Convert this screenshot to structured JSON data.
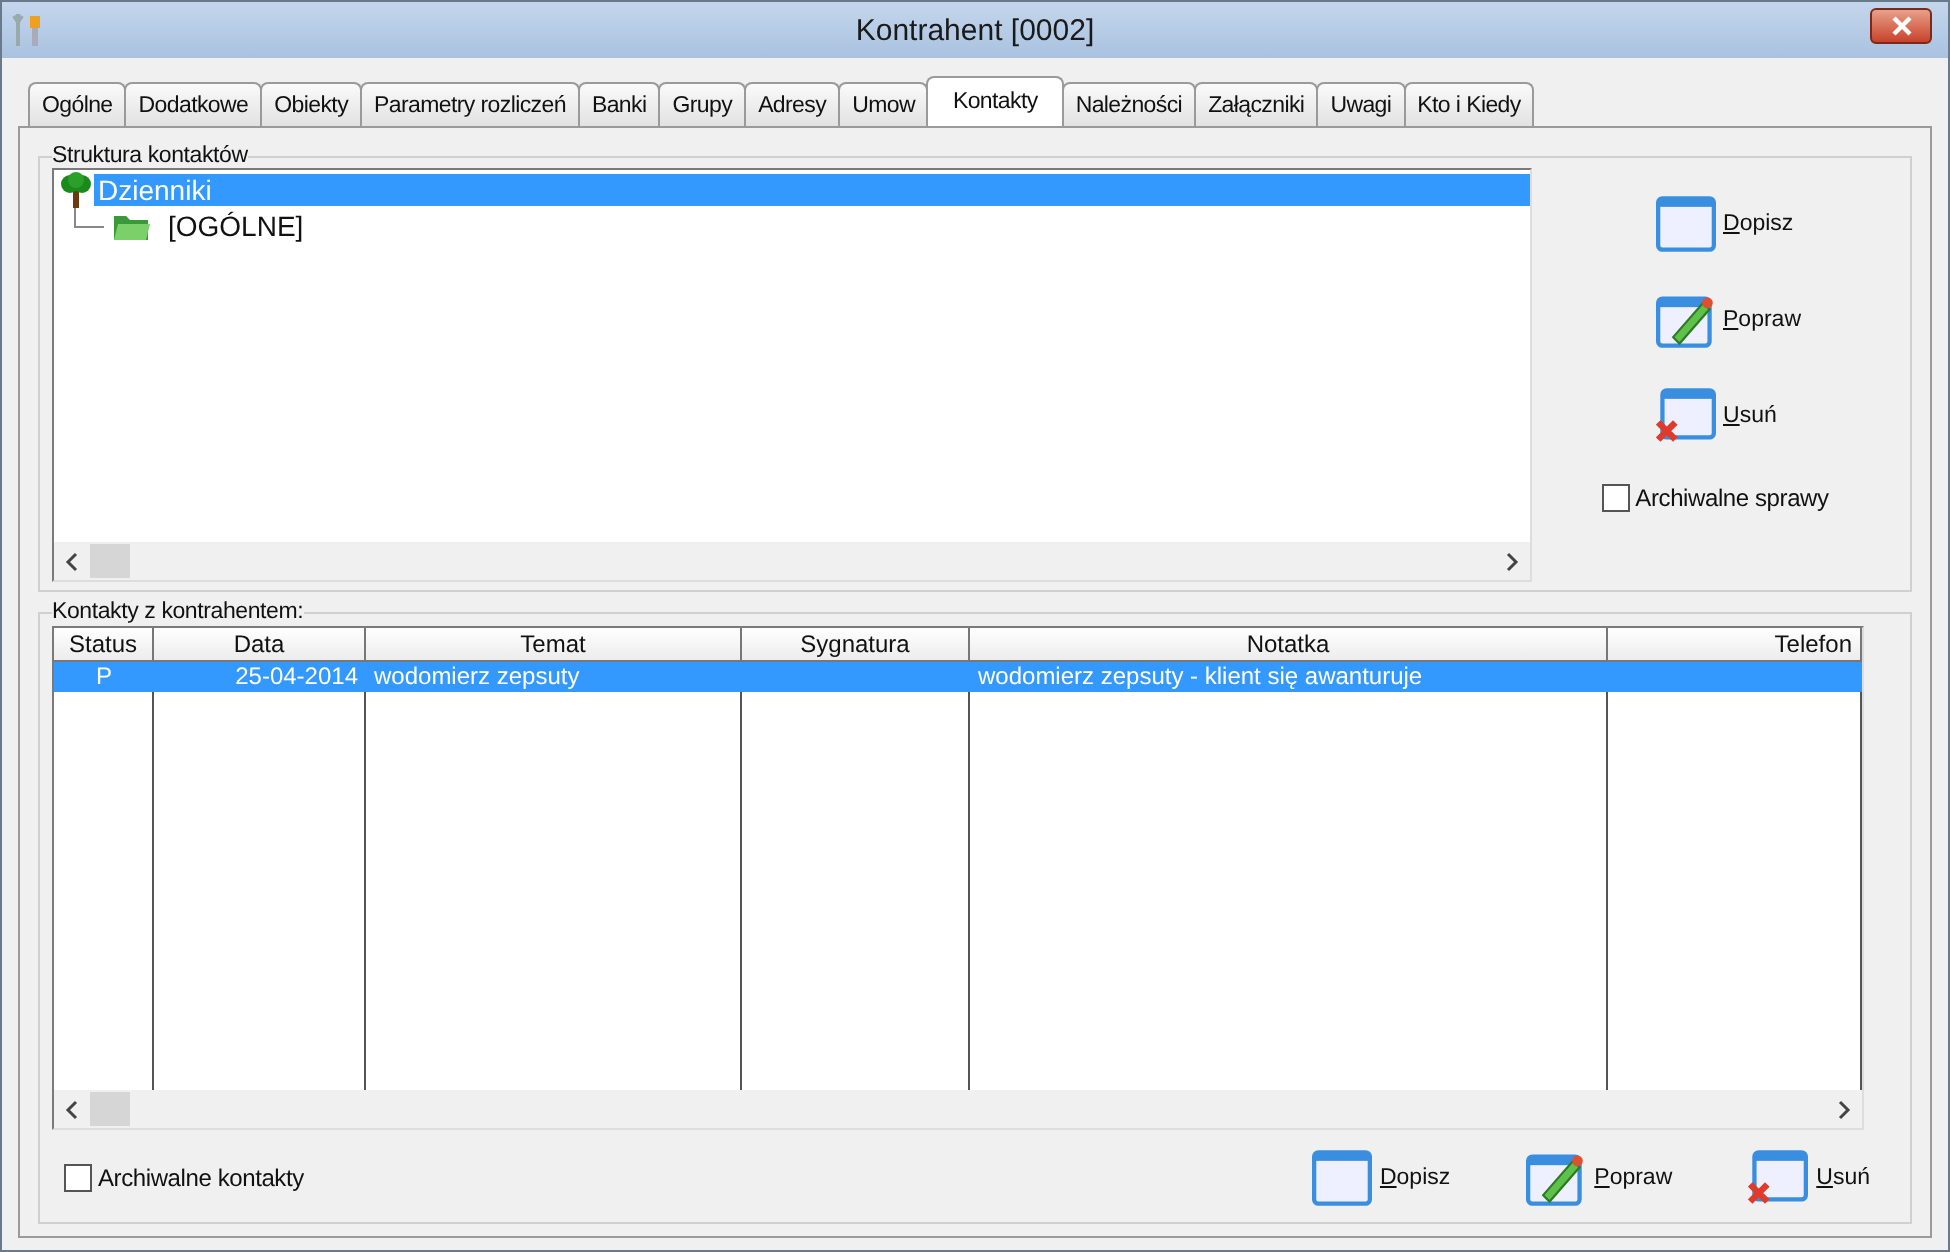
{
  "window": {
    "title": "Kontrahent [0002]"
  },
  "tabs": [
    {
      "label": "Ogólne",
      "selected": false
    },
    {
      "label": "Dodatkowe",
      "selected": false
    },
    {
      "label": "Obiekty",
      "selected": false
    },
    {
      "label": "Parametry rozliczeń",
      "selected": false
    },
    {
      "label": "Banki",
      "selected": false
    },
    {
      "label": "Grupy",
      "selected": false
    },
    {
      "label": "Adresy",
      "selected": false
    },
    {
      "label": "Umow",
      "selected": false
    },
    {
      "label": "Kontakty",
      "selected": true
    },
    {
      "label": "Należności",
      "selected": false
    },
    {
      "label": "Załączniki",
      "selected": false
    },
    {
      "label": "Uwagi",
      "selected": false
    },
    {
      "label": "Kto i Kiedy",
      "selected": false
    }
  ],
  "structure": {
    "title": "Struktura kontaktów",
    "tree": [
      {
        "label": "Dzienniki",
        "selected": true,
        "children": [
          {
            "label": "[OGÓLNE]",
            "selected": false
          }
        ]
      }
    ],
    "buttons": [
      {
        "kind": "add",
        "label": "Dopisz"
      },
      {
        "kind": "edit",
        "label": "Popraw"
      },
      {
        "kind": "delete",
        "label": "Usuń"
      }
    ],
    "archive": {
      "label": "Archiwalne sprawy",
      "checked": false
    }
  },
  "contacts": {
    "title": "Kontakty z kontrahentem:",
    "columns": [
      "Status",
      "Data",
      "Temat",
      "Sygnatura",
      "Notatka",
      "Telefon"
    ],
    "rows": [
      {
        "selected": true,
        "cells": [
          "P",
          "25-04-2014",
          "wodomierz zepsuty",
          "",
          "wodomierz zepsuty - klient się awanturuje",
          ""
        ]
      }
    ],
    "archive": {
      "label": "Archiwalne kontakty",
      "checked": false
    },
    "buttons": [
      {
        "kind": "add",
        "label": "Dopisz"
      },
      {
        "kind": "edit",
        "label": "Popraw"
      },
      {
        "kind": "delete",
        "label": "Usuń"
      }
    ]
  }
}
